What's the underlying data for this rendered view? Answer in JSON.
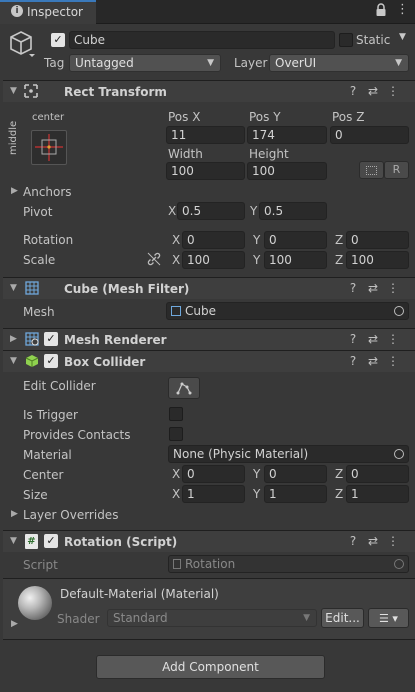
{
  "tab": {
    "title": "Inspector"
  },
  "object": {
    "name": "Cube",
    "static_label": "Static",
    "tag_label": "Tag",
    "tag_value": "Untagged",
    "layer_label": "Layer",
    "layer_value": "OverUI"
  },
  "rect_transform": {
    "title": "Rect Transform",
    "anchor_h": "center",
    "anchor_v": "middle",
    "pos_x_label": "Pos X",
    "pos_y_label": "Pos Y",
    "pos_z_label": "Pos Z",
    "pos_x": "11",
    "pos_y": "174",
    "pos_z": "0",
    "width_label": "Width",
    "height_label": "Height",
    "width": "100",
    "height": "100",
    "r_button": "R",
    "anchors_label": "Anchors",
    "pivot_label": "Pivot",
    "pivot_x": "0.5",
    "pivot_y": "0.5",
    "rotation_label": "Rotation",
    "rot_x": "0",
    "rot_y": "0",
    "rot_z": "0",
    "scale_label": "Scale",
    "scale_x": "100",
    "scale_y": "100",
    "scale_z": "100"
  },
  "axes": {
    "x": "X",
    "y": "Y",
    "z": "Z"
  },
  "mesh_filter": {
    "title": "Cube (Mesh Filter)",
    "mesh_label": "Mesh",
    "mesh_value": "Cube"
  },
  "mesh_renderer": {
    "title": "Mesh Renderer"
  },
  "box_collider": {
    "title": "Box Collider",
    "edit_collider_label": "Edit Collider",
    "is_trigger_label": "Is Trigger",
    "provides_contacts_label": "Provides Contacts",
    "material_label": "Material",
    "material_value": "None (Physic Material)",
    "center_label": "Center",
    "center_x": "0",
    "center_y": "0",
    "center_z": "0",
    "size_label": "Size",
    "size_x": "1",
    "size_y": "1",
    "size_z": "1",
    "layer_overrides_label": "Layer Overrides"
  },
  "rotation_script": {
    "title": "Rotation (Script)",
    "script_label": "Script",
    "script_value": "Rotation"
  },
  "material": {
    "title": "Default-Material (Material)",
    "shader_label": "Shader",
    "shader_value": "Standard",
    "edit_button": "Edit..."
  },
  "add_component": {
    "label": "Add Component"
  },
  "icons": [
    "info-icon",
    "lock-icon",
    "kebab-menu-icon",
    "cube-icon",
    "rect-transform-icon",
    "mesh-filter-icon",
    "mesh-renderer-icon",
    "box-collider-icon",
    "script-icon",
    "help-icon",
    "preset-icon",
    "object-picker-icon",
    "edit-collider-icon",
    "link-icon",
    "list-icon"
  ],
  "colors": {
    "background": "#383838",
    "header": "#3e3e3e",
    "field": "#2a2a2a",
    "tab_accent": "#3a79bb",
    "collider_green": "#8fd14f"
  }
}
